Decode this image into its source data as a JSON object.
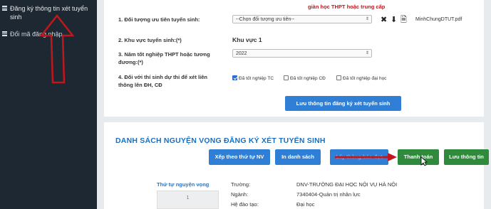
{
  "sidebar": {
    "items": [
      {
        "label": "Đăng ký thông tin xét tuyển sinh"
      },
      {
        "label": "Đổi mã đăng nhập"
      }
    ]
  },
  "form": {
    "note": "giàn học THPT hoặc trung cấp",
    "row1": {
      "label": "1. Đối tượng ưu tiên tuyển sinh:",
      "select_value": "--Chọn đối tượng ưu tiên--",
      "file_name": "MinhChungDTUT.pdf"
    },
    "row2": {
      "label": "2. Khu vực tuyển sinh:(*)",
      "value": "Khu vực 1"
    },
    "row3": {
      "label_line1": "3. Năm tốt nghiệp THPT hoặc tương",
      "label_line2": "đương:(*)",
      "select_value": "2022"
    },
    "row4": {
      "label_line1": "4. Đối với thí sinh dự thi để xét liên",
      "label_line2": "thông lên ĐH, CĐ",
      "options": [
        {
          "label": "Đã tốt nghiệp TC",
          "checked": true
        },
        {
          "label": "Đã tốt nghiệp CĐ",
          "checked": false
        },
        {
          "label": "Đã tốt nghiệp đại học",
          "checked": false
        }
      ]
    },
    "save_button": "Lưu thông tin đăng ký xét tuyển sinh"
  },
  "wishlist": {
    "title": "DANH SÁCH NGUYỆN VỌNG ĐĂNG KÝ XÉT TUYỂN SINH",
    "buttons": {
      "sort": "Xếp theo thứ tự NV",
      "print": "In danh sách",
      "hidden": "Lấy thông báo đợt",
      "pay": "Thanh toán",
      "save": "Lưu thông tin"
    },
    "order_label": "Thứ tự nguyện vọng",
    "order_value": "1",
    "details": [
      {
        "key": "Trường:",
        "value": "DNV-TRƯỜNG ĐẠI HỌC NỘI VỤ HÀ NỘI"
      },
      {
        "key": "Ngành:",
        "value": "7340404-Quản trị nhân lực"
      },
      {
        "key": "Hệ đào tạo:",
        "value": "Đại học"
      }
    ]
  },
  "colors": {
    "sidebar_bg": "#1e2832",
    "accent_blue": "#2f7fd6",
    "accent_green": "#2f8a3b",
    "annotation_red": "#c0171d"
  }
}
